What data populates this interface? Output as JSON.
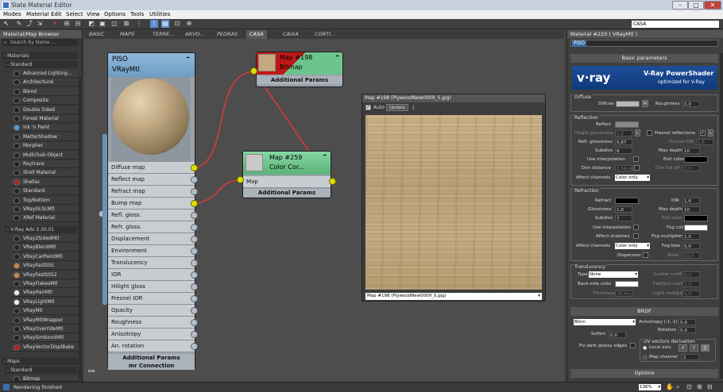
{
  "window": {
    "title": "Slate Material Editor"
  },
  "menu": [
    "Modes",
    "Material",
    "Edit",
    "Select",
    "View",
    "Options",
    "Tools",
    "Utilities"
  ],
  "toolbar": {
    "view_select": "CASA"
  },
  "browser": {
    "title": "Material/Map Browser",
    "search_placeholder": "Search by Name ...",
    "materials_header": "- Materials",
    "standard_header": "- Standard",
    "standard_items": [
      "Advanced Lighting...",
      "Architectural",
      "Blend",
      "Composite",
      "Double Sided",
      "Forest Material",
      "Ink 'n Paint",
      "Matte/Shadow",
      "Morpher",
      "Multi/Sub-Object",
      "Raytrace",
      "Shell Material",
      "Shellac",
      "Standard",
      "Top/Bottom",
      "VRayGLSLMtl",
      "XRef Material"
    ],
    "vray_header": "- V-Ray Adv 2.30.01",
    "vray_items": [
      "VRay2SidedMtl",
      "VRayBlendMtl",
      "VRayCarPaintMtl",
      "VRayFastSSS",
      "VRayFastSSS2",
      "VRayFlakesMtl",
      "VRayHairMtl",
      "VRayLightMtl",
      "VRayMtl",
      "VRayMtlWrapper",
      "VRayOverrideMtl",
      "VRaySimbiontMtl",
      "VRayVectorDisplBake"
    ],
    "maps_header": "- Maps",
    "maps_standard_header": "- Standard",
    "maps_first_item": "Bitmap"
  },
  "tabs": [
    "BASIC",
    "MAPS",
    "TERRE...",
    "ARVO...",
    "PEDRAS",
    "CASA",
    "CAIXA",
    "CORTI..."
  ],
  "active_tab": "CASA",
  "node_main": {
    "name": "PISO",
    "type": "VRayMtl",
    "slots": [
      "Diffuse map",
      "Reflect map",
      "Refract map",
      "Bump map",
      "Refl. gloss.",
      "Refr. gloss.",
      "Displacement",
      "Environment",
      "Translucency",
      "IOR",
      "Hilight gloss",
      "Fresnel IOR",
      "Opacity",
      "Roughness",
      "Anisotropy",
      "An. rotation"
    ],
    "active_slots": [
      "Diffuse map",
      "Bump map"
    ],
    "footer1": "Additional Params",
    "footer2": "mr Connection"
  },
  "node_map198": {
    "name": "Map #198",
    "type": "Bitmap",
    "footer": "Additional Params"
  },
  "node_map259": {
    "name": "Map #259",
    "type": "Color Cor...",
    "slot": "Map",
    "footer": "Additional Params"
  },
  "map_preview": {
    "title": "Map #198 (PlywoodNew0009_S.jpg)",
    "auto_label": "Auto",
    "update_label": "Update",
    "selector": "Map #198 (PlywoodNew0009_S.jpg)"
  },
  "material_panel": {
    "title": "Material #220 ( VRayMtl )",
    "name": "PISO",
    "rollout_basic": "Basic parameters",
    "vray_logo": "V-Ray PowerShader",
    "vray_sub": "optimized for V-Ray",
    "diffuse": {
      "group": "Diffuse",
      "diffuse_label": "Diffuse",
      "m": "M",
      "roughness_label": "Roughness",
      "roughness": "0,0"
    },
    "reflection": {
      "group": "Reflection",
      "reflect": "Reflect",
      "hilight": "Hilight glossiness",
      "hilight_val": "1,0",
      "l": "L",
      "fresnel": "Fresnel reflections",
      "fresnel_l": "L",
      "refl_gloss": "Refl. glossiness",
      "refl_gloss_val": "0,67",
      "fresnel_ior": "Fresnel IOR",
      "fresnel_ior_val": "1,6",
      "subdivs": "Subdivs",
      "subdivs_val": "8",
      "max_depth": "Max depth",
      "max_depth_val": "10",
      "use_interp": "Use interpolation",
      "exit_color": "Exit color",
      "dim_distance": "Dim distance",
      "dim_distance_val": "2,54cm",
      "dim_falloff": "Dim fall off",
      "dim_falloff_val": "0,0",
      "affect_channels": "Affect channels",
      "affect_val": "Color only"
    },
    "refraction": {
      "group": "Refraction",
      "refract": "Refract",
      "ior": "IOR",
      "ior_val": "1,6",
      "glossiness": "Glossiness",
      "glossiness_val": "1,0",
      "max_depth": "Max depth",
      "max_depth_val": "10",
      "subdivs": "Subdivs",
      "subdivs_val": "7",
      "exit_color": "Exit color",
      "use_interp": "Use interpolation",
      "fog_color": "Fog color",
      "affect_shadows": "Affect shadows",
      "fog_mult": "Fog multiplier",
      "fog_mult_val": "1,0",
      "affect_channels": "Affect channels",
      "affect_val": "Color only",
      "fog_bias": "Fog bias",
      "fog_bias_val": "0,0",
      "dispersion": "Dispersion",
      "abbe": "Abbe",
      "abbe_val": "50,0"
    },
    "translucency": {
      "group": "Translucency",
      "type": "Type",
      "type_val": "None",
      "scatter": "Scatter coeff",
      "scatter_val": "0,0",
      "back_side": "Back-side color",
      "fwd_bck": "Fwd/bck coeff",
      "fwd_bck_val": "1,0",
      "thickness": "Thickness",
      "thickness_val": "25,4m",
      "light_mult": "Light multiplier",
      "light_mult_val": "1,0"
    },
    "brdf": {
      "rollout": "BRDF",
      "type_val": "Blinn",
      "anisotropy": "Anisotropy (-1..1)",
      "anisotropy_val": "0,0",
      "rotation": "Rotation",
      "rotation_val": "0,0",
      "soften": "Soften",
      "soften_val": "0,0",
      "uv_group": "UV vectors derivation",
      "local_axis": "Local axis",
      "x": "X",
      "y": "Y",
      "z": "Z",
      "fix_dark": "Fix dark glossy edges",
      "map_channel": "Map channel",
      "map_channel_val": "1"
    },
    "rollout_options": "Options"
  },
  "status": {
    "text": "Rendering finished",
    "zoom": "136%"
  }
}
